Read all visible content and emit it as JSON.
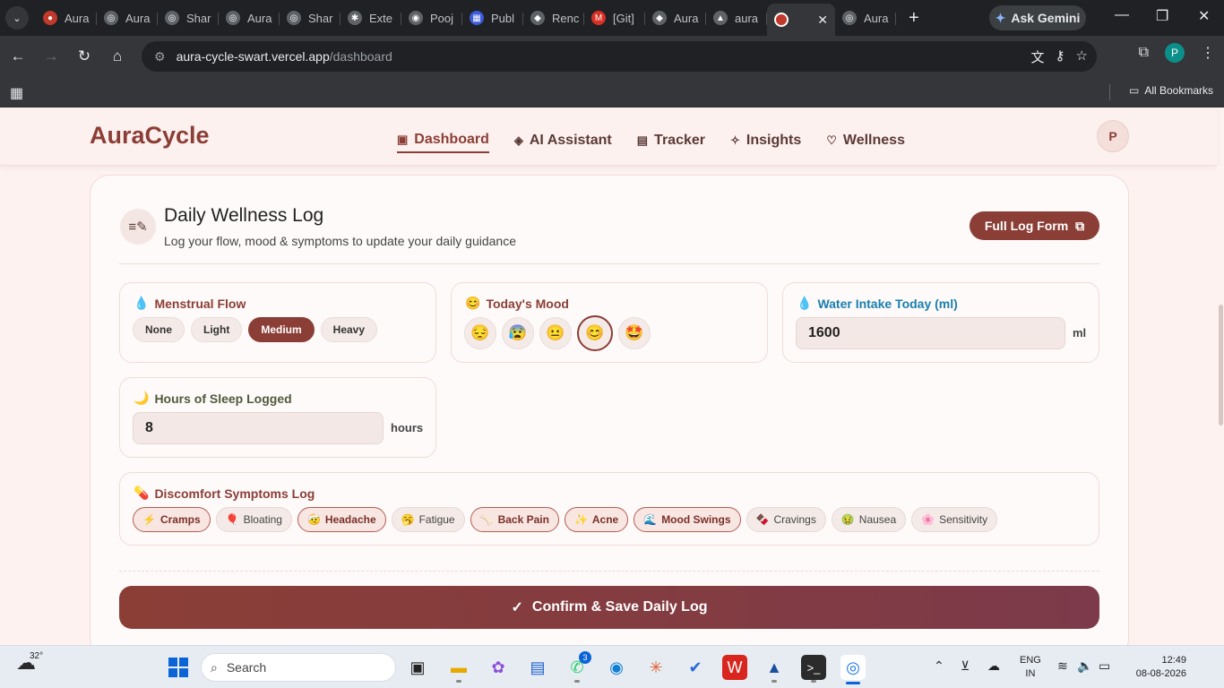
{
  "browser": {
    "tabs": [
      {
        "label": "Aura",
        "favicon_color": "#c0392b",
        "favicon_glyph": "●"
      },
      {
        "label": "Aura",
        "favicon_color": "#5f6368",
        "favicon_glyph": "◎"
      },
      {
        "label": "Shar",
        "favicon_color": "#5f6368",
        "favicon_glyph": "◎"
      },
      {
        "label": "Aura",
        "favicon_color": "#5f6368",
        "favicon_glyph": "◎"
      },
      {
        "label": "Shar",
        "favicon_color": "#5f6368",
        "favicon_glyph": "◎"
      },
      {
        "label": "Exte",
        "favicon_color": "#5f6368",
        "favicon_glyph": "✱"
      },
      {
        "label": "Pooj",
        "favicon_color": "#5f6368",
        "favicon_glyph": "◉"
      },
      {
        "label": "Publ",
        "favicon_color": "#3b5bdb",
        "favicon_glyph": "▦"
      },
      {
        "label": "Renc",
        "favicon_color": "#5f6368",
        "favicon_glyph": "◆"
      },
      {
        "label": "[Git]",
        "favicon_color": "#d93025",
        "favicon_glyph": "M"
      },
      {
        "label": "Aura",
        "favicon_color": "#5f6368",
        "favicon_glyph": "◆"
      },
      {
        "label": "aura",
        "favicon_color": "#5f6368",
        "favicon_glyph": "▲"
      }
    ],
    "active_tab": {
      "label": "",
      "favicon_color": "#c0392b"
    },
    "after_tab": {
      "label": "Aura"
    },
    "gemini_label": "Ask Gemini",
    "url_host": "aura-cycle-swart.vercel.app",
    "url_path": "/dashboard",
    "profile_initial": "P",
    "bookmarks_label": "All Bookmarks"
  },
  "app": {
    "logo": "AuraCycle",
    "nav": [
      {
        "label": "Dashboard",
        "icon": "dashboard-icon",
        "glyph": "▣"
      },
      {
        "label": "AI Assistant",
        "icon": "robot-icon",
        "glyph": "◈"
      },
      {
        "label": "Tracker",
        "icon": "calendar-icon",
        "glyph": "▤"
      },
      {
        "label": "Insights",
        "icon": "sparkle-icon",
        "glyph": "✧"
      },
      {
        "label": "Wellness",
        "icon": "heart-icon",
        "glyph": "♡"
      }
    ],
    "active_nav": "Dashboard",
    "avatar_initial": "P"
  },
  "log": {
    "title": "Daily Wellness Log",
    "subtitle": "Log your flow, mood & symptoms to update your daily guidance",
    "full_log_label": "Full Log Form",
    "flow": {
      "label": "Menstrual Flow",
      "options": [
        "None",
        "Light",
        "Medium",
        "Heavy"
      ],
      "selected": "Medium"
    },
    "mood": {
      "label": "Today's Mood",
      "options": [
        "😔",
        "😰",
        "😐",
        "😊",
        "🤩"
      ],
      "selected_index": 3
    },
    "water": {
      "label": "Water Intake Today (ml)",
      "value": "1600",
      "unit": "ml"
    },
    "sleep": {
      "label": "Hours of Sleep Logged",
      "value": "8",
      "unit": "hours"
    },
    "symptoms": {
      "label": "Discomfort Symptoms Log",
      "items": [
        {
          "label": "Cramps",
          "emoji": "⚡",
          "selected": true
        },
        {
          "label": "Bloating",
          "emoji": "🎈",
          "selected": false
        },
        {
          "label": "Headache",
          "emoji": "🤕",
          "selected": true
        },
        {
          "label": "Fatigue",
          "emoji": "🥱",
          "selected": false
        },
        {
          "label": "Back Pain",
          "emoji": "🦴",
          "selected": true
        },
        {
          "label": "Acne",
          "emoji": "✨",
          "selected": true
        },
        {
          "label": "Mood Swings",
          "emoji": "🌊",
          "selected": true
        },
        {
          "label": "Cravings",
          "emoji": "🍫",
          "selected": false
        },
        {
          "label": "Nausea",
          "emoji": "🤢",
          "selected": false
        },
        {
          "label": "Sensitivity",
          "emoji": "🌸",
          "selected": false
        }
      ]
    },
    "confirm_label": "Confirm & Save Daily Log"
  },
  "taskbar": {
    "temperature": "32°",
    "search_placeholder": "Search",
    "whatsapp_badge": "3",
    "lang_line1": "ENG",
    "lang_line2": "IN",
    "time": "12:49",
    "date": "08-08-2026"
  }
}
